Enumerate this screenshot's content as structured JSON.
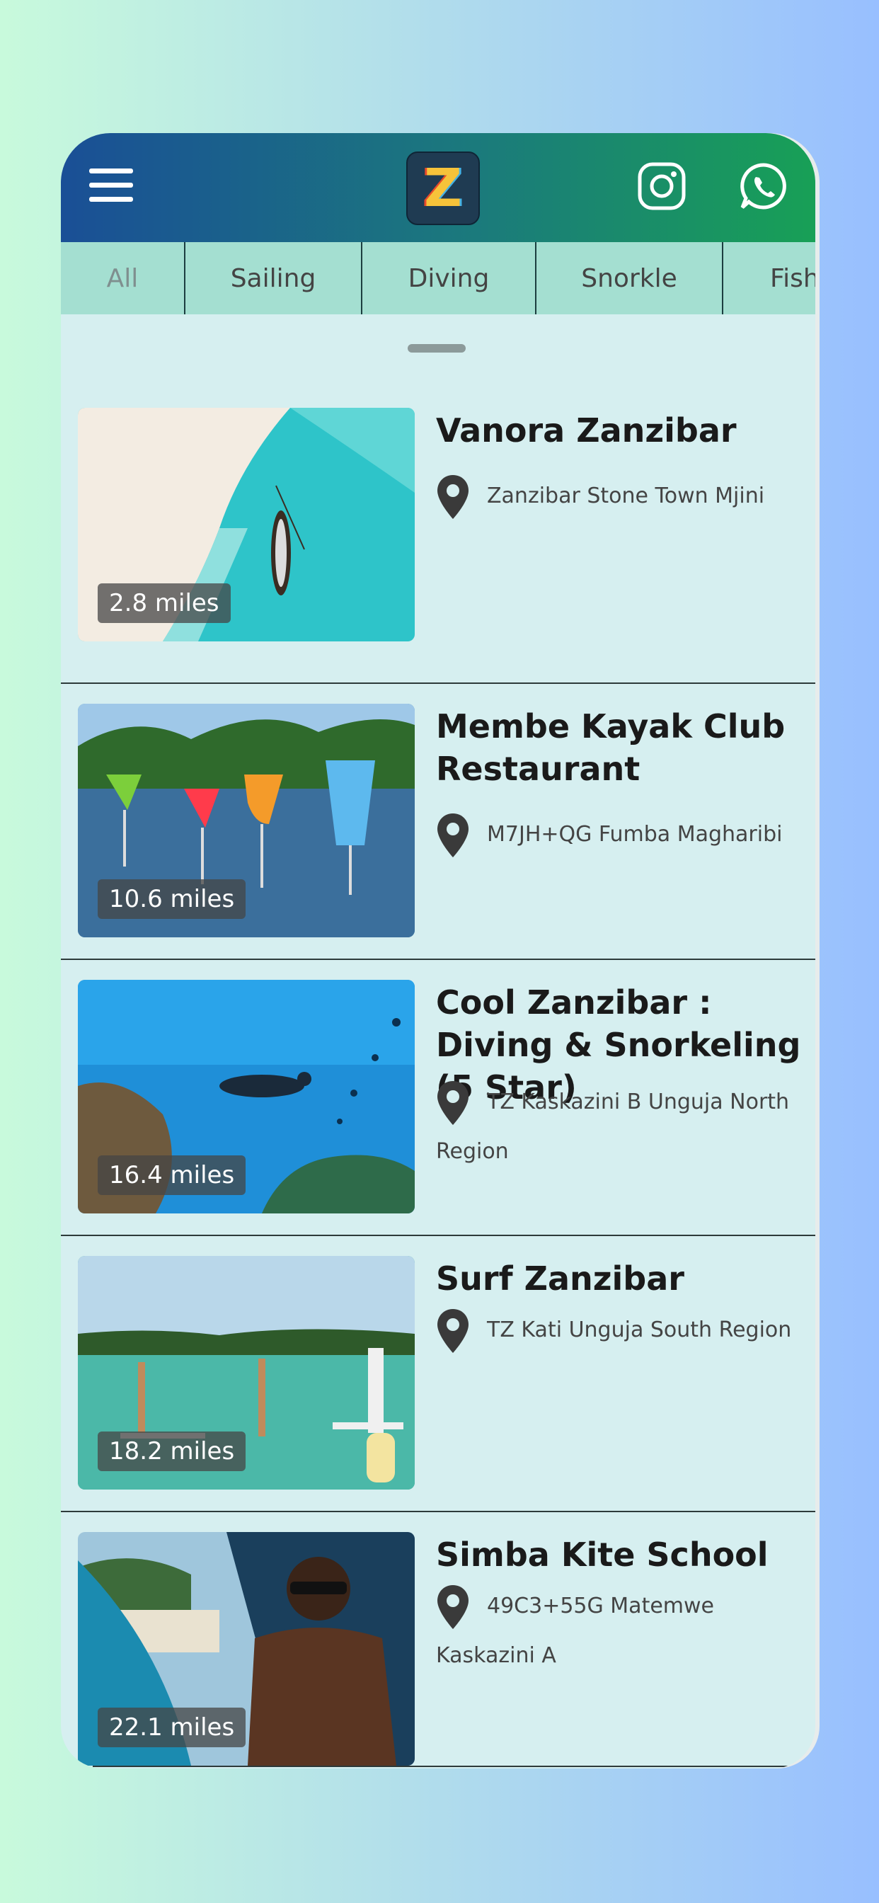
{
  "header": {
    "logo_text": "Z",
    "menu_icon": "hamburger-menu-icon",
    "instagram_icon": "instagram-icon",
    "whatsapp_icon": "whatsapp-icon"
  },
  "tabs": [
    {
      "label": "All",
      "active": true
    },
    {
      "label": "Sailing"
    },
    {
      "label": "Diving"
    },
    {
      "label": "Snorkle"
    },
    {
      "label": "Fish"
    }
  ],
  "listings": [
    {
      "title": "Vanora Zanzibar",
      "address": "Zanzibar Stone Town Mjini",
      "distance": "2.8 miles",
      "image": "beach-boat-aerial"
    },
    {
      "title": "Membe Kayak Club Restaurant",
      "address": "M7JH+QG Fumba Magharibi",
      "distance": "10.6 miles",
      "image": "cocktails-by-sea"
    },
    {
      "title": "Cool Zanzibar : Diving & Snorkeling (5 Star)",
      "address": "TZ Kaskazini B Unguja North Region",
      "distance": "16.4 miles",
      "image": "scuba-diver-reef"
    },
    {
      "title": "Surf Zanzibar",
      "address": "TZ Kati Unguja South Region",
      "distance": "18.2 miles",
      "image": "paddleboard-yoga"
    },
    {
      "title": "Simba Kite School",
      "address": "49C3+55G Matemwe Kaskazini A",
      "distance": "22.1 miles",
      "image": "kite-surfer"
    }
  ],
  "colors": {
    "appbar_start": "#1a4f96",
    "appbar_end": "#18a056",
    "tab_bg": "#a4dfd1",
    "page_bg": "#d6eff0"
  }
}
